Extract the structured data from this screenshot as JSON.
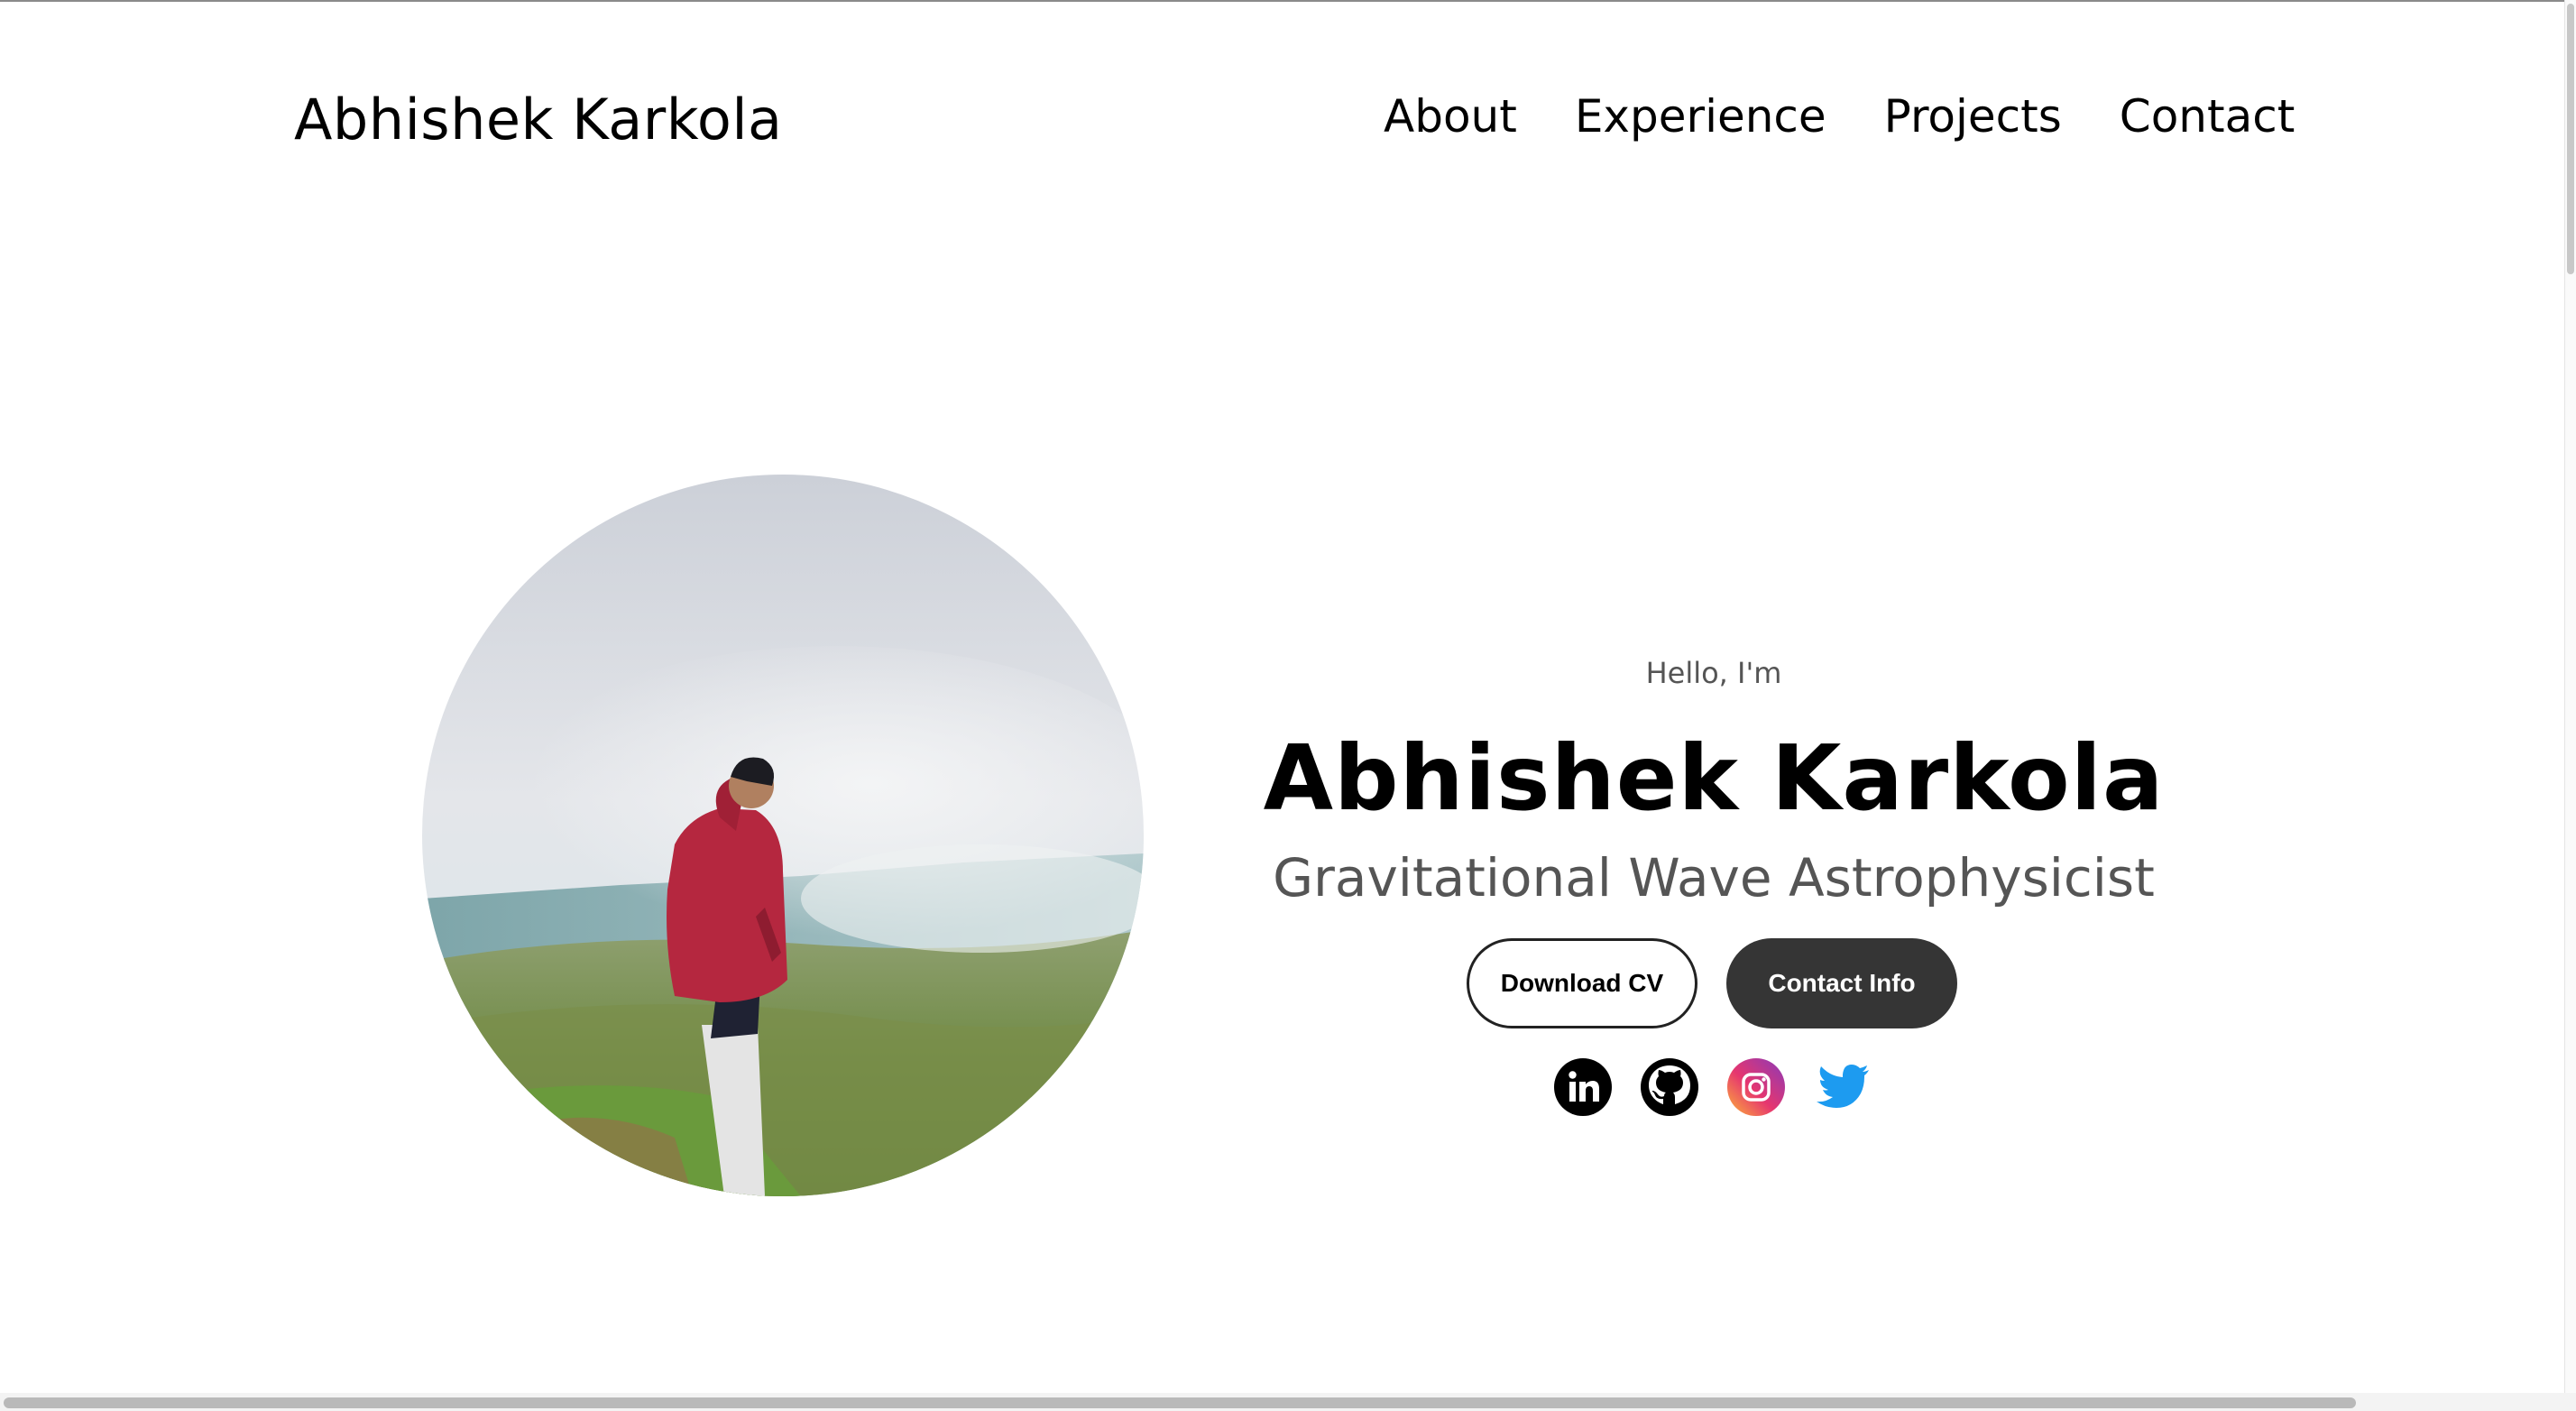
{
  "header": {
    "logo": "Abhishek Karkola",
    "nav": [
      {
        "label": "About"
      },
      {
        "label": "Experience"
      },
      {
        "label": "Projects"
      },
      {
        "label": "Contact"
      }
    ]
  },
  "hero": {
    "greeting": "Hello, I'm",
    "name": "Abhishek Karkola",
    "title": "Gravitational Wave Astrophysicist",
    "buttons": {
      "download": "Download CV",
      "contact": "Contact Info"
    },
    "socials": [
      {
        "icon": "linkedin-icon"
      },
      {
        "icon": "github-icon"
      },
      {
        "icon": "instagram-icon"
      },
      {
        "icon": "twitter-icon"
      }
    ]
  },
  "colors": {
    "button_dark": "#353535",
    "twitter": "#1d9bf0",
    "text_muted": "#555555"
  }
}
